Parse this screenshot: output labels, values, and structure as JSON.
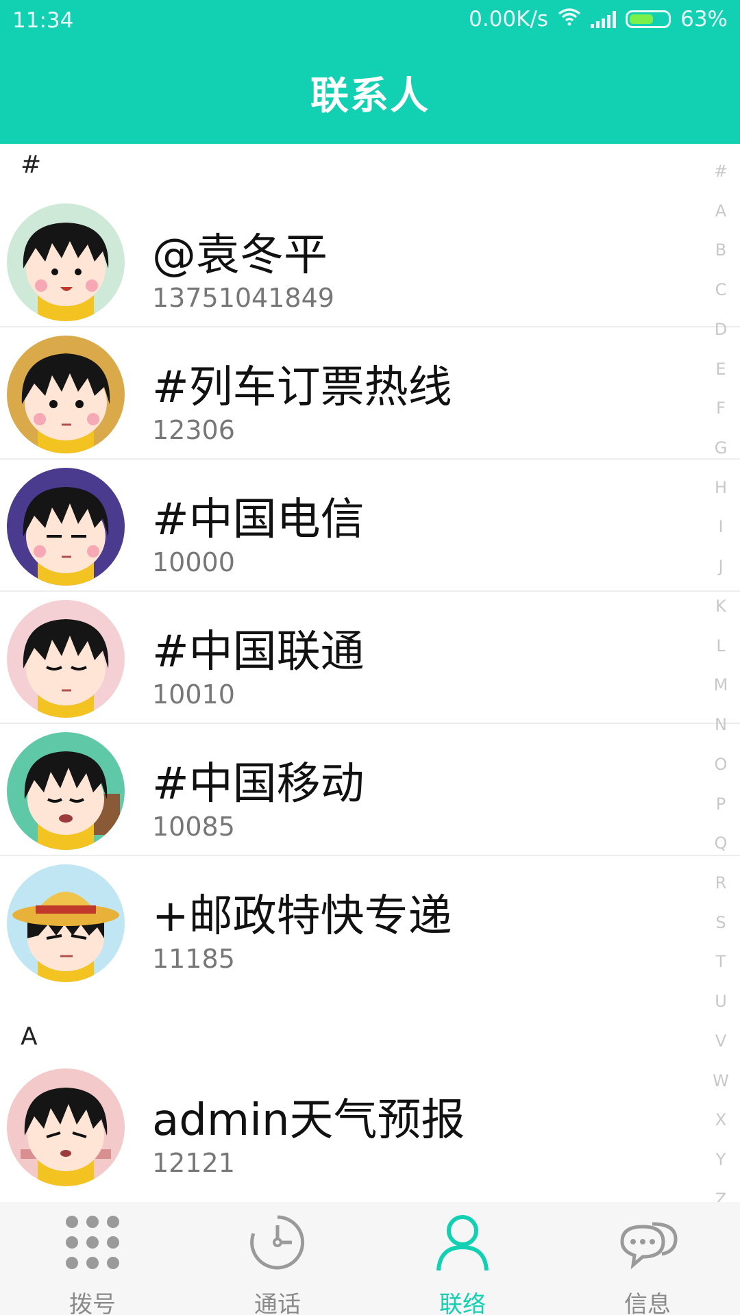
{
  "status_bar": {
    "time": "11:34",
    "network_speed": "0.00K/s",
    "battery": "63%",
    "battery_level": 0.63,
    "icons": [
      "wifi-icon",
      "signal-icon",
      "battery-icon"
    ]
  },
  "header": {
    "title": "联系人"
  },
  "colors": {
    "accent": "#12d0b2",
    "text": "#111111",
    "secondary": "#777777",
    "divider": "#ececec"
  },
  "sections": [
    {
      "letter": "#",
      "contacts": [
        {
          "name": "@袁冬平",
          "number": "13751041849"
        },
        {
          "name": "#列车订票热线",
          "number": "12306"
        },
        {
          "name": "#中国电信",
          "number": "10000"
        },
        {
          "name": "#中国联通",
          "number": "10010"
        },
        {
          "name": "#中国移动",
          "number": "10085"
        },
        {
          "name": "+邮政特快专递",
          "number": "11185"
        }
      ]
    },
    {
      "letter": "A",
      "contacts": [
        {
          "name": "admin天气预报",
          "number": "12121"
        }
      ]
    }
  ],
  "alpha_index": [
    "#",
    "A",
    "B",
    "C",
    "D",
    "E",
    "F",
    "G",
    "H",
    "I",
    "J",
    "K",
    "L",
    "M",
    "N",
    "O",
    "P",
    "Q",
    "R",
    "S",
    "T",
    "U",
    "V",
    "W",
    "X",
    "Y",
    "Z"
  ],
  "tabs": [
    {
      "label": "拨号",
      "icon": "dialpad-icon"
    },
    {
      "label": "通话",
      "icon": "call-log-icon"
    },
    {
      "label": "联络",
      "icon": "contacts-icon",
      "active": true
    },
    {
      "label": "信息",
      "icon": "message-icon"
    }
  ]
}
